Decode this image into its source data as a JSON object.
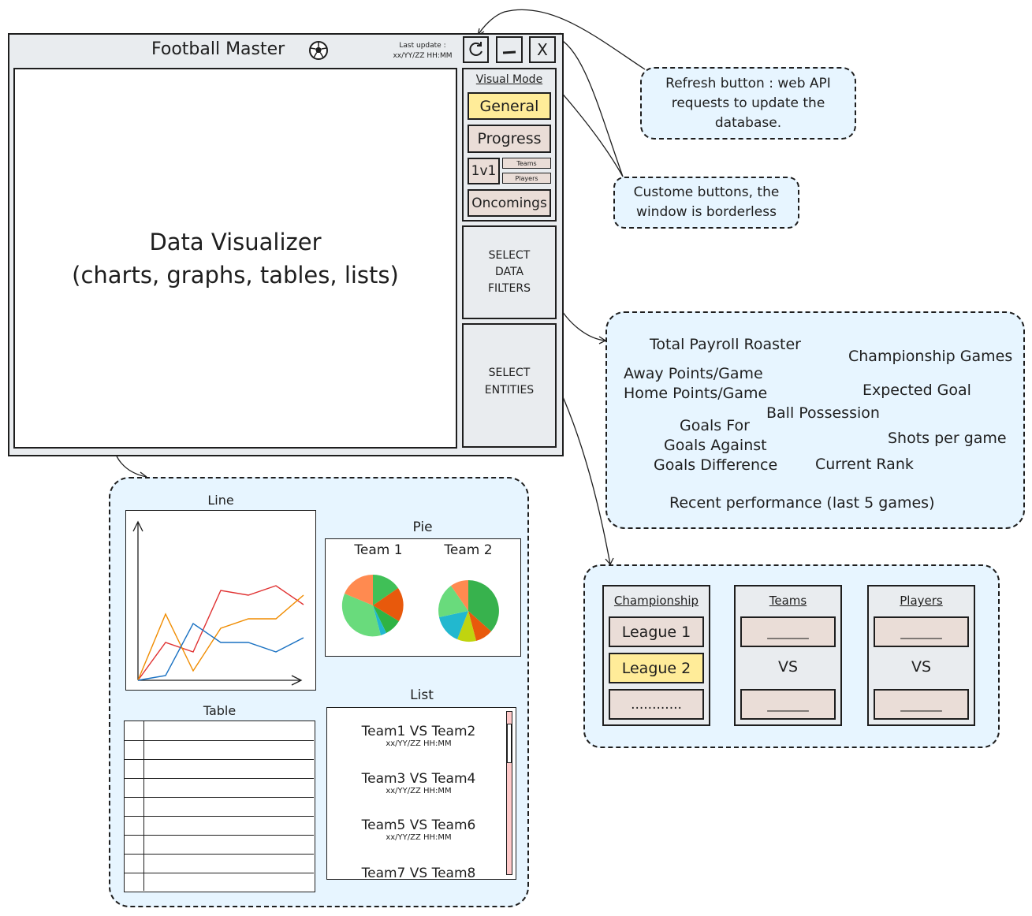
{
  "app": {
    "title": "Football Master",
    "last_update_label": "Last update :",
    "last_update_value": "xx/YY/ZZ HH:MM",
    "visualizer_line1": "Data Visualizer",
    "visualizer_line2": "(charts, graphs, tables, lists)",
    "refresh_icon": "refresh-icon",
    "minimize_icon": "minimize-icon",
    "close_label": "X"
  },
  "visual_mode": {
    "heading": "Visual Mode",
    "general": "General",
    "progress": "Progress",
    "one_v_one": "1v1",
    "teams": "Teams",
    "players": "Players",
    "oncomings": "Oncomings"
  },
  "filters": {
    "line1": "SELECT",
    "line2": "DATA",
    "line3": "FILTERS"
  },
  "entities_btn": {
    "line1": "SELECT",
    "line2": "ENTITIES"
  },
  "notes": {
    "refresh": "Refresh button : web API requests to update the database.",
    "custom": "Custome buttons, the window is borderless"
  },
  "filter_options": {
    "total_payroll": "Total Payroll Roaster",
    "championship_games": "Championship Games",
    "away_points": "Away Points/Game",
    "home_points": "Home Points/Game",
    "expected_goal": "Expected Goal",
    "ball_possession": "Ball Possession",
    "goals_for": "Goals For",
    "shots_per_game": "Shots per game",
    "goals_against": "Goals Against",
    "goals_difference": "Goals Difference",
    "current_rank": "Current Rank",
    "recent_performance": "Recent performance (last 5 games)"
  },
  "entities": {
    "championship_heading": "Championship",
    "league1": "League 1",
    "league2": "League 2",
    "more": "............",
    "teams_heading": "Teams",
    "players_heading": "Players",
    "blank": "_______",
    "vs": "VS"
  },
  "examples": {
    "line_title": "Line",
    "pie_title": "Pie",
    "team1": "Team 1",
    "team2": "Team 2",
    "table_title": "Table",
    "list_title": "List",
    "list_items": [
      {
        "match": "Team1 VS Team2",
        "date": "xx/YY/ZZ HH:MM"
      },
      {
        "match": "Team3 VS Team4",
        "date": "xx/YY/ZZ HH:MM"
      },
      {
        "match": "Team5 VS Team6",
        "date": "xx/YY/ZZ HH:MM"
      },
      {
        "match": "Team7 VS Team8",
        "date": ""
      }
    ]
  },
  "colors": {
    "canvas": "#ffffff",
    "app_bg": "#e9ecef",
    "note_bg": "#e7f5ff",
    "selected": "#ffec99",
    "option": "#eaddd7",
    "line_red": "#e03131",
    "line_orange": "#f08c00",
    "line_blue": "#1971c2",
    "scrollbar": "#ffc9c9"
  },
  "chart_data": {
    "type": "line",
    "series": [
      {
        "color": "#e03131",
        "values": [
          0,
          40,
          30,
          95,
          90,
          100,
          80
        ]
      },
      {
        "color": "#f08c00",
        "values": [
          0,
          70,
          10,
          55,
          65,
          65,
          90
        ]
      },
      {
        "color": "#1971c2",
        "values": [
          0,
          5,
          60,
          40,
          40,
          30,
          45
        ]
      }
    ]
  }
}
